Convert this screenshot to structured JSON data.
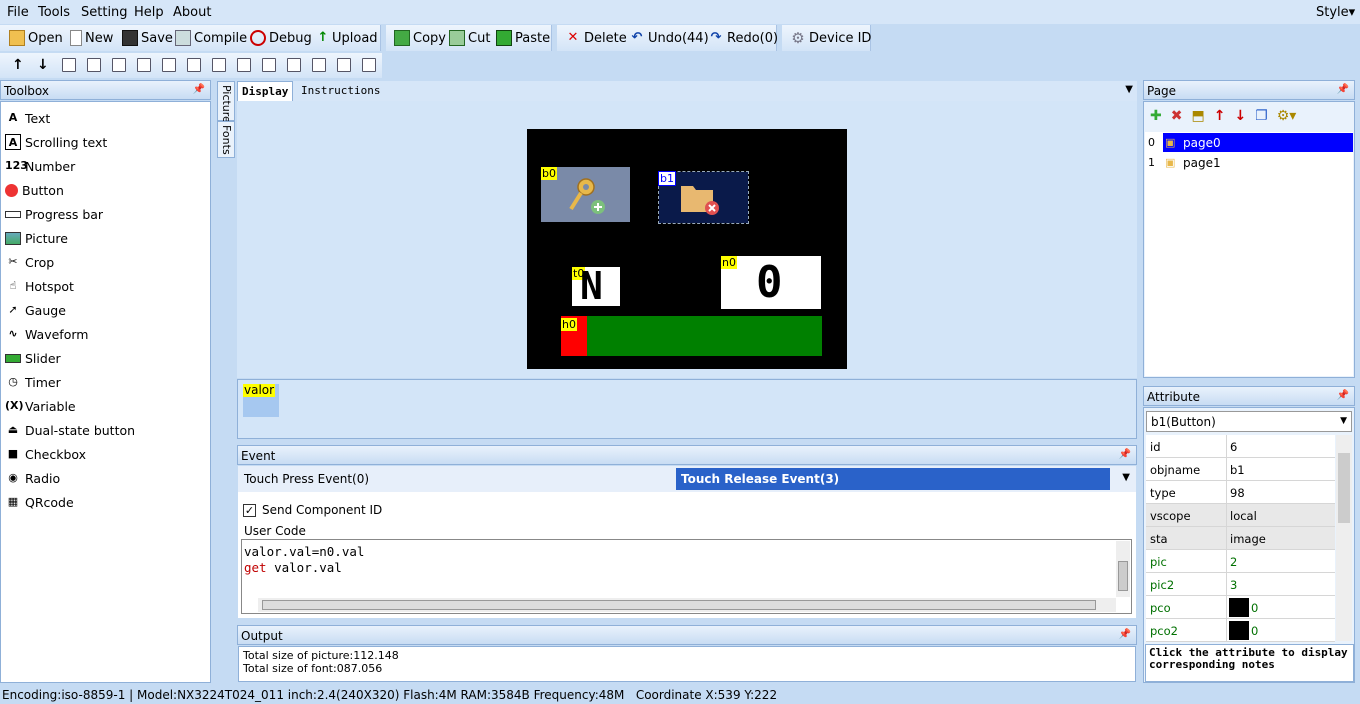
{
  "menu": [
    "File",
    "Tools",
    "Setting",
    "Help",
    "About"
  ],
  "style_menu": "Style",
  "toolbar": {
    "open": "Open",
    "new": "New",
    "save": "Save",
    "compile": "Compile",
    "debug": "Debug",
    "upload": "Upload",
    "copy": "Copy",
    "cut": "Cut",
    "paste": "Paste",
    "delete": "Delete",
    "undo": "Undo(44)",
    "redo": "Redo(0)",
    "device_id": "Device  ID"
  },
  "toolbox": {
    "title": "Toolbox",
    "items": [
      {
        "label": "Text",
        "icon": "text-icon",
        "glyph": "A"
      },
      {
        "label": "Scrolling text",
        "icon": "scrolling-text-icon",
        "glyph": "A"
      },
      {
        "label": "Number",
        "icon": "number-icon",
        "glyph": "123"
      },
      {
        "label": "Button",
        "icon": "button-icon",
        "glyph": ""
      },
      {
        "label": "Progress bar",
        "icon": "progress-bar-icon",
        "glyph": ""
      },
      {
        "label": "Picture",
        "icon": "picture-icon",
        "glyph": ""
      },
      {
        "label": "Crop",
        "icon": "crop-icon",
        "glyph": "✂"
      },
      {
        "label": "Hotspot",
        "icon": "hotspot-icon",
        "glyph": "☝"
      },
      {
        "label": "Gauge",
        "icon": "gauge-icon",
        "glyph": "➚"
      },
      {
        "label": "Waveform",
        "icon": "waveform-icon",
        "glyph": "∿"
      },
      {
        "label": "Slider",
        "icon": "slider-icon",
        "glyph": ""
      },
      {
        "label": "Timer",
        "icon": "timer-icon",
        "glyph": "◷"
      },
      {
        "label": "Variable",
        "icon": "variable-icon",
        "glyph": "(X)"
      },
      {
        "label": "Dual-state button",
        "icon": "dual-state-button-icon",
        "glyph": "⏏"
      },
      {
        "label": "Checkbox",
        "icon": "checkbox-icon",
        "glyph": "■"
      },
      {
        "label": "Radio",
        "icon": "radio-icon",
        "glyph": "◉"
      },
      {
        "label": "QRcode",
        "icon": "qrcode-icon",
        "glyph": "▦"
      }
    ]
  },
  "side_tabs": [
    "Picture",
    "Fonts"
  ],
  "display_tabs": [
    "Display",
    "Instructions"
  ],
  "components": {
    "b0": "b0",
    "b1": "b1",
    "t0": "t0",
    "t0_text": "N",
    "n0": "n0",
    "n0_text": "0",
    "h0": "h0",
    "h0_value": 10
  },
  "variable_strip": {
    "label": "valor"
  },
  "event": {
    "title": "Event",
    "tab_press": "Touch Press Event(0)",
    "tab_release": "Touch Release Event(3)",
    "send_id_label": "Send Component ID",
    "send_id_checked": true,
    "user_code_label": "User Code",
    "code_line1": "valor.val=n0.val",
    "code_line2_keyword": "get",
    "code_line2_rest": " valor.val"
  },
  "output": {
    "title": "Output",
    "lines": [
      "Total size of picture:112.148",
      "Total size of font:087.056"
    ]
  },
  "page_panel": {
    "title": "Page",
    "pages": [
      {
        "index": "0",
        "name": "page0"
      },
      {
        "index": "1",
        "name": "page1"
      }
    ]
  },
  "attribute_panel": {
    "title": "Attribute",
    "selected": "b1(Button)",
    "rows": [
      {
        "k": "id",
        "v": "6"
      },
      {
        "k": "objname",
        "v": "b1"
      },
      {
        "k": "type",
        "v": "98"
      },
      {
        "k": "vscope",
        "v": "local"
      },
      {
        "k": "sta",
        "v": "image"
      },
      {
        "k": "pic",
        "v": "2"
      },
      {
        "k": "pic2",
        "v": "3"
      },
      {
        "k": "pco",
        "v": "0"
      },
      {
        "k": "pco2",
        "v": "0"
      }
    ],
    "note": "Click the attribute to display corresponding notes"
  },
  "status": {
    "encoding": "Encoding:iso-8859-1",
    "model": "Model:NX3224T024_011  inch:2.4(240X320) Flash:4M RAM:3584B Frequency:48M",
    "coordinate": "Coordinate X:539  Y:222"
  },
  "colors": {
    "selected_blue": "#0000ff",
    "release_tab": "#2a62c9",
    "green_attr": "#007000",
    "keyword_red": "#c00000"
  }
}
